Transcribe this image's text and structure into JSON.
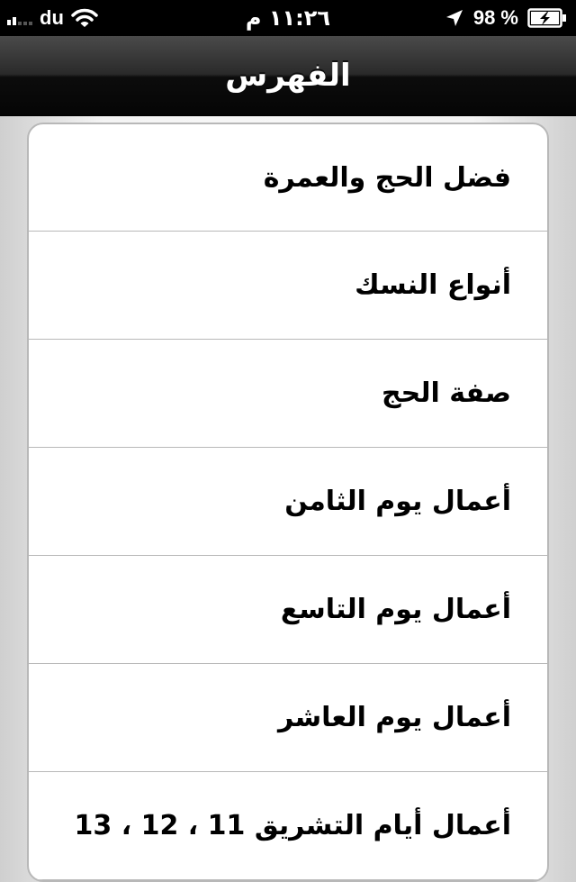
{
  "status_bar": {
    "carrier": "du",
    "time": "١١:٢٦ م",
    "battery_percent": "98 %",
    "icons": [
      "signal-icon",
      "wifi-icon",
      "location-icon",
      "battery-charging-icon"
    ]
  },
  "nav": {
    "title": "الفهرس"
  },
  "list": {
    "items": [
      {
        "label": "فضل الحج والعمرة"
      },
      {
        "label": "أنواع النسك"
      },
      {
        "label": "صفة الحج"
      },
      {
        "label": "أعمال يوم الثامن"
      },
      {
        "label": "أعمال يوم التاسع"
      },
      {
        "label": "أعمال يوم العاشر"
      },
      {
        "label": "أعمال أيام التشريق 11 ، 12 ، 13"
      }
    ]
  },
  "colors": {
    "status_bar_bg": "#000000",
    "nav_bar_bg": "#0c0c0c",
    "list_bg": "#ffffff",
    "separator": "#b8b8b8",
    "page_bg": "#f4f4f4"
  }
}
